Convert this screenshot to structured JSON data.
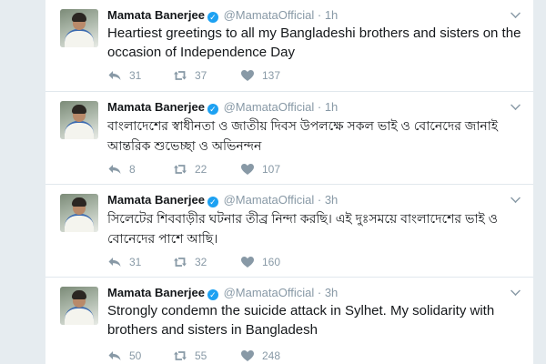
{
  "tweets": [
    {
      "name": "Mamata Banerjee",
      "handle": "@MamataOfficial",
      "separator": "·",
      "time": "1h",
      "text": "Heartiest greetings to all my Bangladeshi brothers and sisters on the occasion of Independence Day",
      "replies": "31",
      "retweets": "37",
      "likes": "137"
    },
    {
      "name": "Mamata Banerjee",
      "handle": "@MamataOfficial",
      "separator": "·",
      "time": "1h",
      "text": "বাংলাদেশের স্বাধীনতা ও জাতীয় দিবস উপলক্ষে সকল ভাই ও বোনেদের জানাই আন্তরিক শুভেচ্ছা ও অভিনন্দন",
      "replies": "8",
      "retweets": "22",
      "likes": "107"
    },
    {
      "name": "Mamata Banerjee",
      "handle": "@MamataOfficial",
      "separator": "·",
      "time": "3h",
      "text": "সিলেটের শিববাড়ীর ঘটনার তীব্র নিন্দা করছি। এই দুঃসময়ে বাংলাদেশের ভাই ও বোনেদের পাশে আছি।",
      "replies": "31",
      "retweets": "32",
      "likes": "160"
    },
    {
      "name": "Mamata Banerjee",
      "handle": "@MamataOfficial",
      "separator": "·",
      "time": "3h",
      "text": "Strongly condemn the suicide attack in Sylhet. My solidarity with brothers and sisters in Bangladesh",
      "replies": "50",
      "retweets": "55",
      "likes": "248"
    }
  ],
  "icons": {
    "verified": "verified-badge-icon",
    "reply": "reply-arrow-icon",
    "retweet": "retweet-icon",
    "like": "heart-icon",
    "menu": "chevron-down-icon"
  },
  "colors": {
    "text": "#14171a",
    "muted": "#8899a6",
    "verified": "#1da1f2",
    "divider": "#e1e8ed",
    "background": "#e6ecf0"
  }
}
